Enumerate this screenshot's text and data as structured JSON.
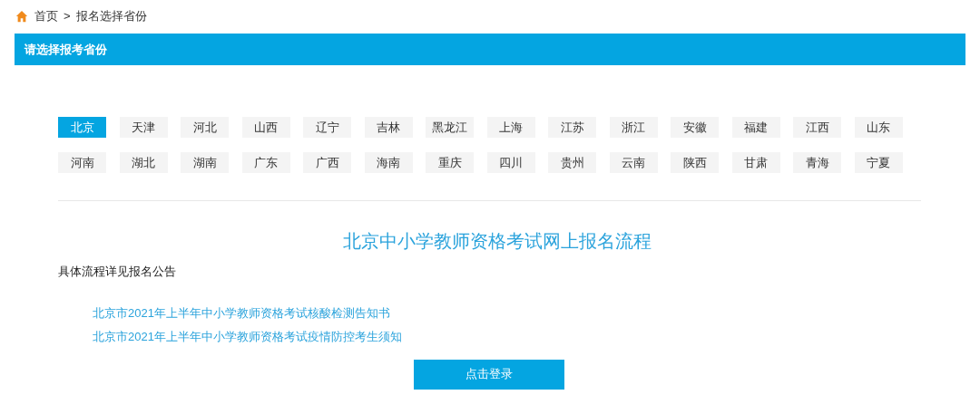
{
  "breadcrumb": {
    "items": [
      "首页",
      "报名选择省份"
    ],
    "separator": ">"
  },
  "header": {
    "title": "请选择报考省份"
  },
  "provinces": [
    {
      "label": "北京",
      "selected": true
    },
    {
      "label": "天津",
      "selected": false
    },
    {
      "label": "河北",
      "selected": false
    },
    {
      "label": "山西",
      "selected": false
    },
    {
      "label": "辽宁",
      "selected": false
    },
    {
      "label": "吉林",
      "selected": false
    },
    {
      "label": "黑龙江",
      "selected": false
    },
    {
      "label": "上海",
      "selected": false
    },
    {
      "label": "江苏",
      "selected": false
    },
    {
      "label": "浙江",
      "selected": false
    },
    {
      "label": "安徽",
      "selected": false
    },
    {
      "label": "福建",
      "selected": false
    },
    {
      "label": "江西",
      "selected": false
    },
    {
      "label": "山东",
      "selected": false
    },
    {
      "label": "河南",
      "selected": false
    },
    {
      "label": "湖北",
      "selected": false
    },
    {
      "label": "湖南",
      "selected": false
    },
    {
      "label": "广东",
      "selected": false
    },
    {
      "label": "广西",
      "selected": false
    },
    {
      "label": "海南",
      "selected": false
    },
    {
      "label": "重庆",
      "selected": false
    },
    {
      "label": "四川",
      "selected": false
    },
    {
      "label": "贵州",
      "selected": false
    },
    {
      "label": "云南",
      "selected": false
    },
    {
      "label": "陕西",
      "selected": false
    },
    {
      "label": "甘肃",
      "selected": false
    },
    {
      "label": "青海",
      "selected": false
    },
    {
      "label": "宁夏",
      "selected": false
    }
  ],
  "content": {
    "title": "北京中小学教师资格考试网上报名流程",
    "note": "具体流程详见报名公告",
    "links": [
      "北京市2021年上半年中小学教师资格考试核酸检测告知书",
      "北京市2021年上半年中小学教师资格考试疫情防控考生须知"
    ],
    "button": "点击登录"
  }
}
